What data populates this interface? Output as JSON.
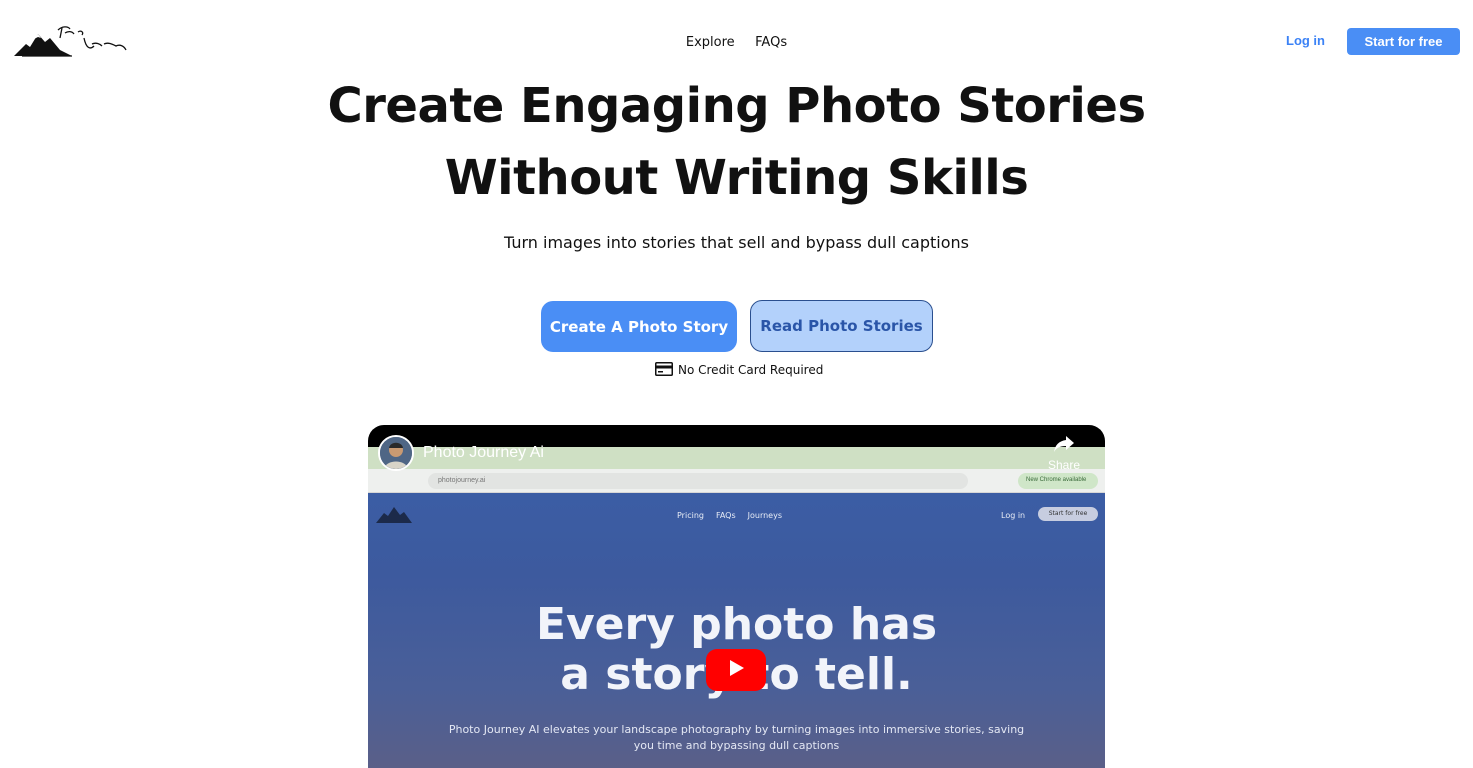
{
  "header": {
    "nav_items": [
      "Explore",
      "FAQs"
    ],
    "login_label": "Log in",
    "start_label": "Start for free"
  },
  "hero": {
    "headline_line1": "Create Engaging Photo Stories",
    "headline_line2": "Without Writing Skills",
    "subheadline": "Turn images into stories that sell and bypass dull captions",
    "primary_cta": "Create A Photo Story",
    "secondary_cta": "Read Photo Stories",
    "note": "No Credit Card Required",
    "note_icon": "credit-card-icon"
  },
  "video": {
    "title": "Photo Journey Ai",
    "share_label": "Share",
    "screen": {
      "url": "photojourney.ai",
      "browser_chip": "New Chrome available",
      "nav_links": [
        "Pricing",
        "FAQs",
        "Journeys"
      ],
      "login_label": "Log in",
      "start_label": "Start for free",
      "title_line1": "Every photo has",
      "title_line2": "a story to tell.",
      "description": "Photo Journey AI elevates your landscape photography by turning images into immersive stories, saving you time and bypassing dull captions"
    }
  },
  "colors": {
    "accent": "#4a8ef5",
    "accent_light": "#b3d1fb",
    "play_red": "#ff0000"
  }
}
